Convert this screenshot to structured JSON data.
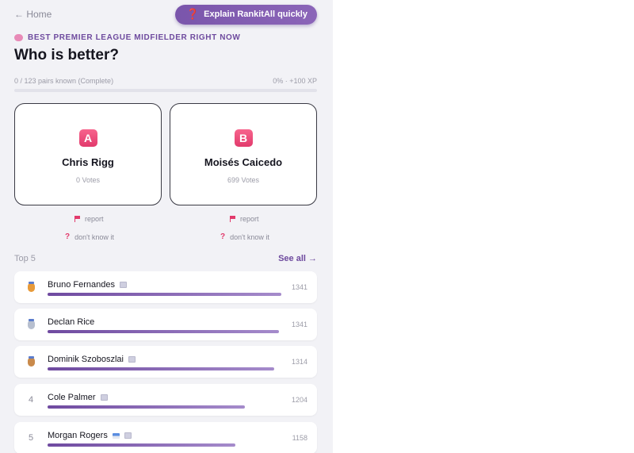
{
  "header": {
    "home_label": "← Home",
    "explain_label": "Explain RankitAll quickly"
  },
  "category": "BEST PREMIER LEAGUE MIDFIELDER RIGHT NOW",
  "page_title": "Who is better?",
  "progress": {
    "left_text": "0 / 123 pairs known (Complete)",
    "right_text": "0% · +100 XP",
    "percent": 0
  },
  "matchup": {
    "a": {
      "badge": "A",
      "name": "Chris Rigg",
      "votes": "0 Votes",
      "report": "report",
      "dont_know": "don't know it"
    },
    "b": {
      "badge": "B",
      "name": "Moisés Caicedo",
      "votes": "699 Votes",
      "report": "report",
      "dont_know": "don't know it"
    }
  },
  "top": {
    "label": "Top 5",
    "see_all": "See all →",
    "rows": [
      {
        "rank": "",
        "medal": "gold",
        "name": "Bruno Fernandes",
        "score": "1341",
        "bar": 0.97
      },
      {
        "rank": "",
        "medal": "silver",
        "name": "Declan Rice",
        "score": "1341",
        "bar": 0.96
      },
      {
        "rank": "",
        "medal": "bronze",
        "name": "Dominik Szoboszlai",
        "score": "1314",
        "bar": 0.94
      },
      {
        "rank": "4",
        "medal": "",
        "name": "Cole Palmer",
        "score": "1204",
        "bar": 0.82
      },
      {
        "rank": "5",
        "medal": "",
        "name": "Morgan Rogers",
        "score": "1158",
        "bar": 0.78
      }
    ]
  },
  "colors": {
    "accent": "#7a55ab",
    "badge": "#e23a6c"
  }
}
